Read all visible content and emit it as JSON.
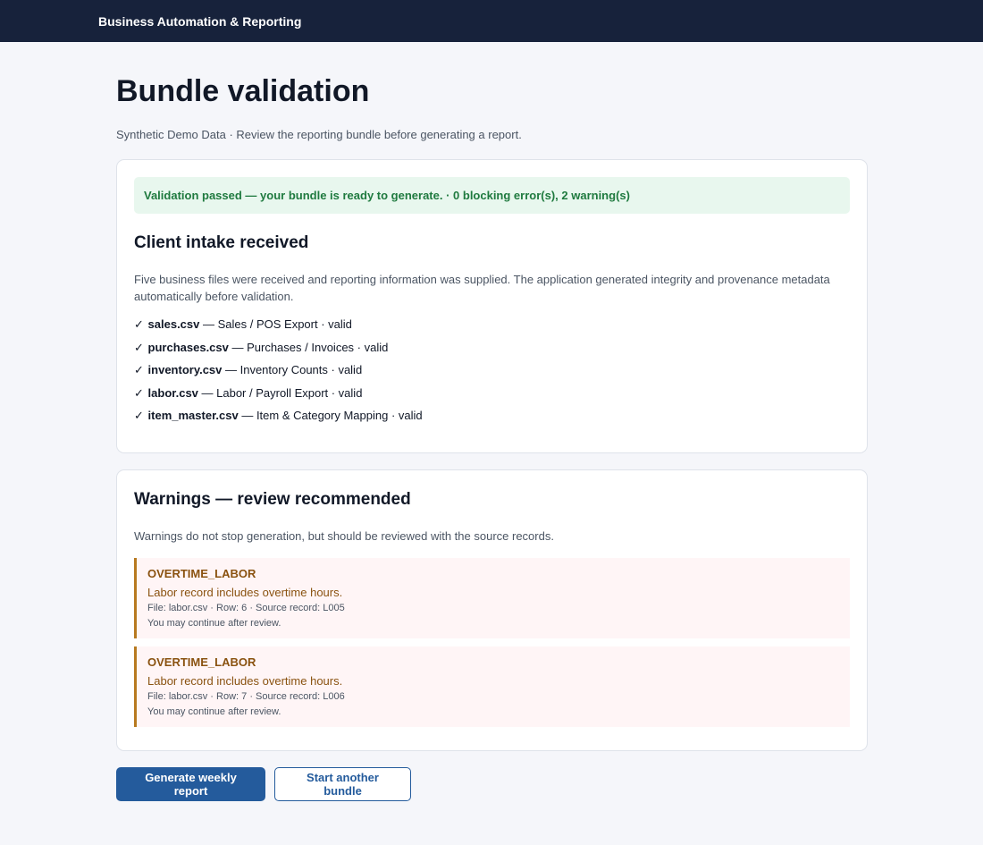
{
  "header": {
    "brand": "Business Automation & Reporting"
  },
  "page": {
    "title": "Bundle validation",
    "subtitle": "Synthetic Demo Data · Review the reporting bundle before generating a report."
  },
  "validation": {
    "status_message": "Validation passed — your bundle is ready to generate. · 0 blocking error(s), 2 warning(s)",
    "status_color": "#1f7a3f"
  },
  "intake": {
    "heading": "Client intake received",
    "description": "Five business files were received and reporting information was supplied. The application generated integrity and provenance metadata automatically before validation.",
    "check_mark": "✓",
    "files": [
      {
        "name": "sales.csv",
        "detail": " — Sales / POS Export · valid"
      },
      {
        "name": "purchases.csv",
        "detail": " — Purchases / Invoices · valid"
      },
      {
        "name": "inventory.csv",
        "detail": " — Inventory Counts · valid"
      },
      {
        "name": "labor.csv",
        "detail": " — Labor / Payroll Export · valid"
      },
      {
        "name": "item_master.csv",
        "detail": " — Item & Category Mapping · valid"
      }
    ]
  },
  "warnings": {
    "heading": "Warnings — review recommended",
    "description": "Warnings do not stop generation, but should be reviewed with the source records.",
    "accent_color": "#b7791f",
    "items": [
      {
        "code": "OVERTIME_LABOR",
        "message": "Labor record includes overtime hours.",
        "meta": "File: labor.csv · Row: 6 · Source record: L005",
        "note": "You may continue after review."
      },
      {
        "code": "OVERTIME_LABOR",
        "message": "Labor record includes overtime hours.",
        "meta": "File: labor.csv · Row: 7 · Source record: L006",
        "note": "You may continue after review."
      }
    ]
  },
  "actions": {
    "primary_label": "Generate weekly report",
    "secondary_label": "Start another bundle",
    "primary_color": "#245b9c"
  }
}
